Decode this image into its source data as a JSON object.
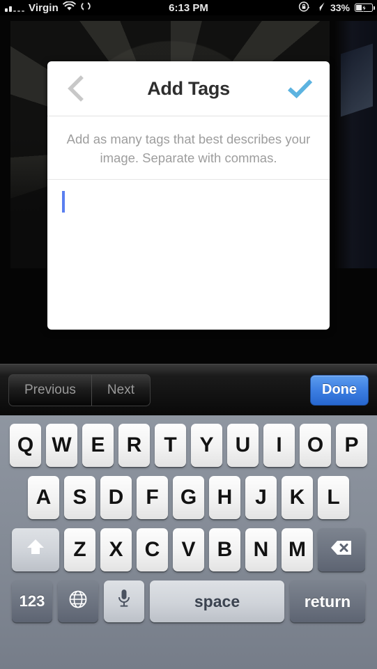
{
  "status_bar": {
    "carrier": "Virgin",
    "time": "6:13 PM",
    "battery_percent": "33%",
    "icons": {
      "signal": "signal-bars-icon",
      "wifi": "wifi-icon",
      "sync": "sync-icon",
      "rotation_lock": "rotation-lock-icon",
      "location": "location-arrow-icon",
      "battery": "battery-charging-icon"
    }
  },
  "modal": {
    "title": "Add Tags",
    "back_icon": "back-chevron-icon",
    "confirm_icon": "checkmark-icon",
    "hint": "Add as many tags that best describes your image. Separate with commas.",
    "tag_input_value": "",
    "tag_input_placeholder": "",
    "accent_check_color": "#5cb3e0",
    "caret_color": "#5a7ff0"
  },
  "accessory_bar": {
    "previous_label": "Previous",
    "next_label": "Next",
    "done_label": "Done",
    "done_color": "#3d7fe2"
  },
  "keyboard": {
    "row1": [
      "Q",
      "W",
      "E",
      "R",
      "T",
      "Y",
      "U",
      "I",
      "O",
      "P"
    ],
    "row2": [
      "A",
      "S",
      "D",
      "F",
      "G",
      "H",
      "J",
      "K",
      "L"
    ],
    "row3": [
      "Z",
      "X",
      "C",
      "V",
      "B",
      "N",
      "M"
    ],
    "shift_icon": "shift-arrow-icon",
    "backspace_icon": "backspace-delete-icon",
    "numbers_label": "123",
    "globe_icon": "globe-icon",
    "mic_icon": "microphone-icon",
    "space_label": "space",
    "return_label": "return"
  }
}
